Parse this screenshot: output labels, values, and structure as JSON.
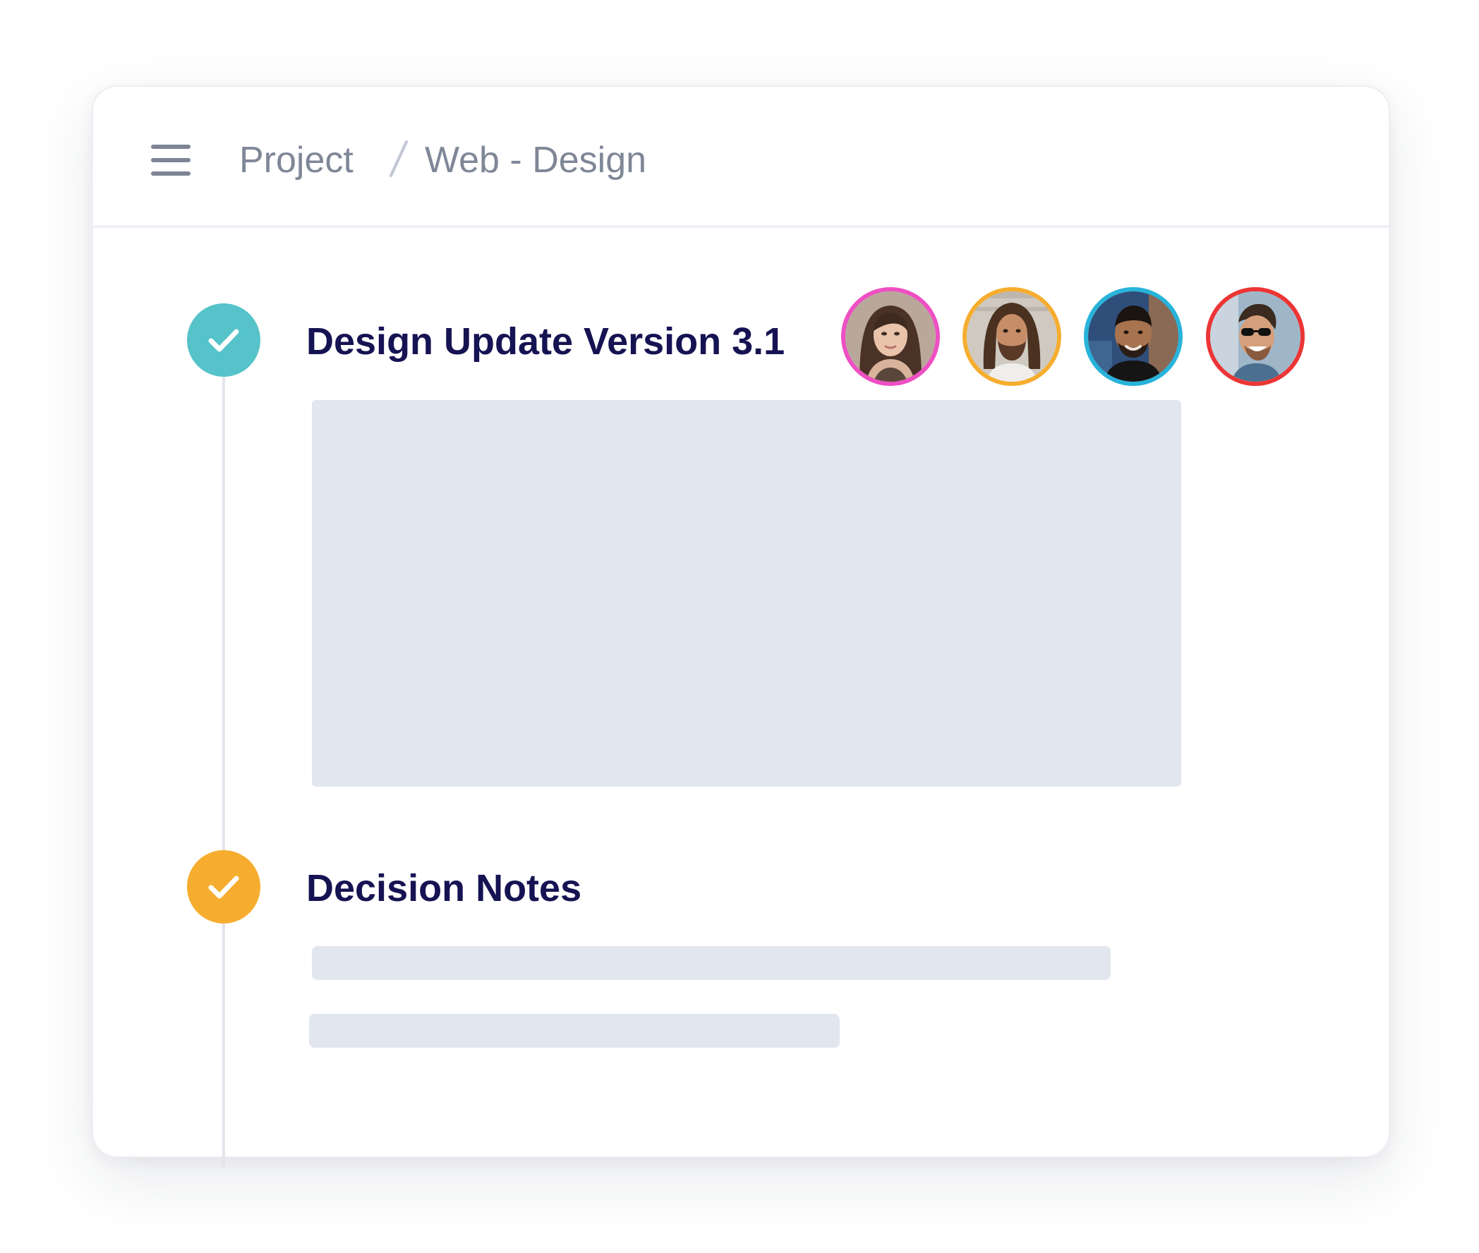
{
  "breadcrumb": {
    "project": "Project",
    "page": "Web - Design"
  },
  "icons": {
    "menu": "hamburger-menu-icon",
    "check": "checkmark-icon"
  },
  "timeline": [
    {
      "title": "Design Update Version 3.1",
      "status_color": "#55c3c9"
    },
    {
      "title": "Decision Notes",
      "status_color": "#f6ad2f"
    }
  ],
  "avatars": [
    {
      "ring_color": "#ee4fc3"
    },
    {
      "ring_color": "#f6ad2f"
    },
    {
      "ring_color": "#28b3da"
    },
    {
      "ring_color": "#ec3535"
    }
  ],
  "colors": {
    "title": "#161353",
    "breadcrumb": "#7f8797",
    "placeholder": "#e2e6ee",
    "separator": "#c2c7d4"
  }
}
